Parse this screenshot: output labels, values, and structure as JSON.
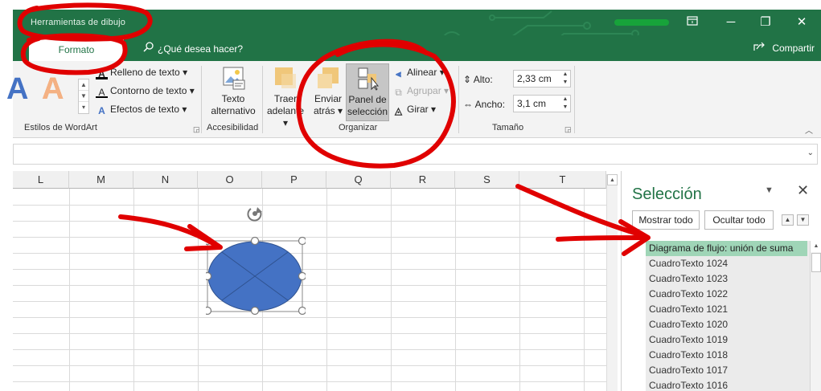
{
  "window": {
    "contextual_title": "Herramientas de dibujo",
    "restore_icon": "ribbon-display-icon",
    "minimize_label": "─",
    "maximize_label": "❐",
    "close_label": "✕"
  },
  "tabs": {
    "active": "Formato",
    "tell_me": "¿Qué desea hacer?",
    "share": "Compartir"
  },
  "ribbon": {
    "wordart": {
      "group_label": "Estilos de WordArt",
      "text_fill": "Relleno de texto",
      "text_outline": "Contorno de texto",
      "text_effects": "Efectos de texto"
    },
    "accessibility": {
      "group_label": "Accesibilidad",
      "alt_text_line1": "Texto",
      "alt_text_line2": "alternativo"
    },
    "arrange": {
      "group_label": "Organizar",
      "bring_forward_line1": "Traer",
      "bring_forward_line2": "adelante",
      "send_backward_line1": "Enviar",
      "send_backward_line2": "atrás",
      "selection_pane_line1": "Panel de",
      "selection_pane_line2": "selección",
      "align": "Alinear",
      "group": "Agrupar",
      "rotate": "Girar"
    },
    "size": {
      "group_label": "Tamaño",
      "height_label": "Alto:",
      "height_value": "2,33 cm",
      "width_label": "Ancho:",
      "width_value": "3,1 cm"
    }
  },
  "grid": {
    "columns": [
      "L",
      "M",
      "N",
      "O",
      "P",
      "Q",
      "R",
      "S",
      "T"
    ]
  },
  "selection_pane": {
    "title": "Selección",
    "show_all": "Mostrar todo",
    "hide_all": "Ocultar todo",
    "items": [
      "Diagrama de flujo: unión de suma",
      "CuadroTexto 1024",
      "CuadroTexto 1023",
      "CuadroTexto 1022",
      "CuadroTexto 1021",
      "CuadroTexto 1020",
      "CuadroTexto 1019",
      "CuadroTexto 1018",
      "CuadroTexto 1017",
      "CuadroTexto 1016"
    ]
  },
  "colors": {
    "excel_green": "#217346",
    "shape_fill": "#4472c4",
    "selected_item": "#9fd5b7",
    "annotation_red": "#e00000"
  }
}
